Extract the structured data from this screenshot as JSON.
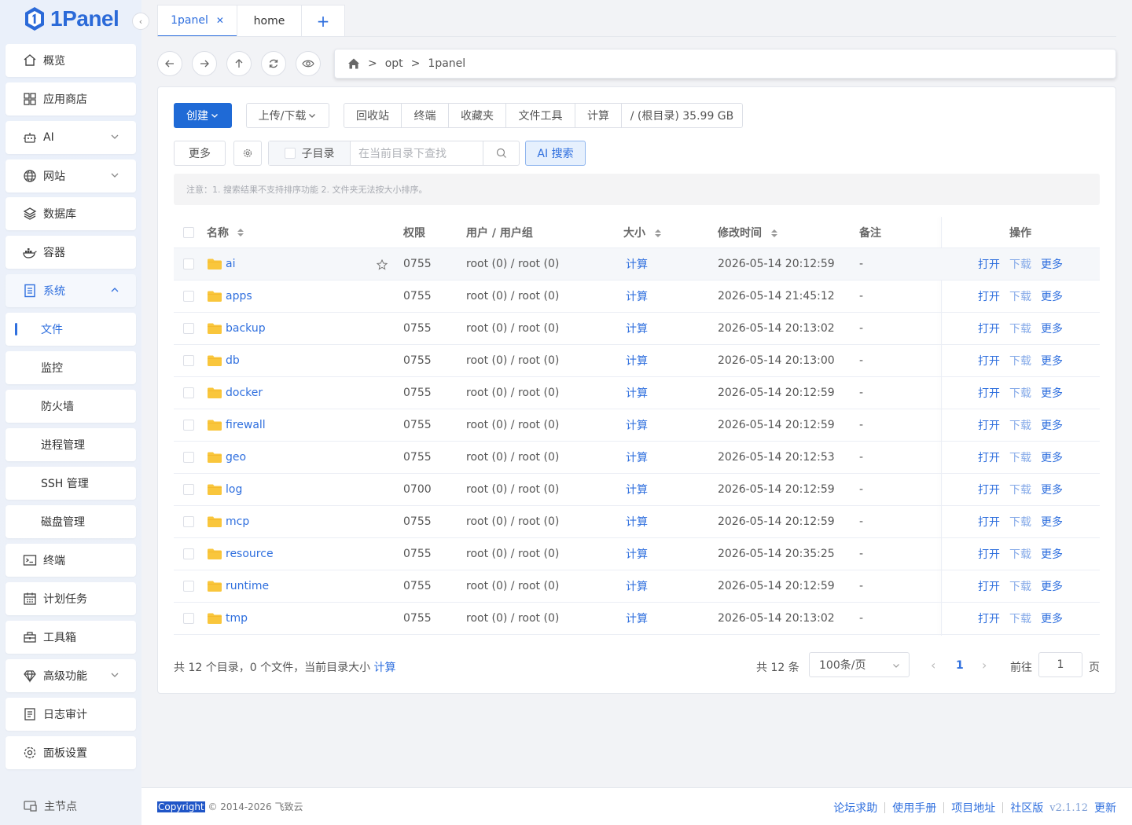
{
  "app": {
    "logo_text": "1Panel"
  },
  "sidebar": {
    "items": [
      {
        "label": "概览",
        "icon": "home-icon"
      },
      {
        "label": "应用商店",
        "icon": "apps-grid-icon"
      },
      {
        "label": "AI",
        "icon": "robot-icon",
        "expandable": true
      },
      {
        "label": "网站",
        "icon": "globe-icon",
        "expandable": true
      },
      {
        "label": "数据库",
        "icon": "database-layers-icon"
      },
      {
        "label": "容器",
        "icon": "docker-icon"
      },
      {
        "label": "系统",
        "icon": "system-doc-icon",
        "expanded": true
      },
      {
        "label": "文件",
        "active": true
      },
      {
        "label": "监控"
      },
      {
        "label": "防火墙"
      },
      {
        "label": "进程管理"
      },
      {
        "label": "SSH 管理"
      },
      {
        "label": "磁盘管理"
      },
      {
        "label": "终端",
        "icon": "terminal-icon"
      },
      {
        "label": "计划任务",
        "icon": "calendar-icon"
      },
      {
        "label": "工具箱",
        "icon": "toolbox-icon"
      },
      {
        "label": "高级功能",
        "icon": "diamond-icon",
        "expandable": true
      },
      {
        "label": "日志审计",
        "icon": "log-icon"
      },
      {
        "label": "面板设置",
        "icon": "settings-gear-icon"
      }
    ],
    "main_node": "主节点"
  },
  "tabs": [
    {
      "label": "1panel",
      "active": true
    },
    {
      "label": "home"
    }
  ],
  "breadcrumb": {
    "sep": ">",
    "parts": [
      "opt",
      "1panel"
    ]
  },
  "toolbar": {
    "create": "创建",
    "upload": "上传/下载",
    "group": [
      "回收站",
      "终端",
      "收藏夹",
      "文件工具",
      "计算",
      "/ (根目录) 35.99 GB"
    ],
    "more": "更多",
    "subdir": "子目录",
    "search_placeholder": "在当前目录下查找",
    "ai_search": "AI 搜索"
  },
  "notice": "注意：1. 搜索结果不支持排序功能 2. 文件夹无法按大小排序。",
  "table": {
    "headers": {
      "name": "名称",
      "perm": "权限",
      "user": "用户 / 用户组",
      "size": "大小",
      "time": "修改时间",
      "note": "备注",
      "ops": "操作"
    },
    "size_action": "计算",
    "ops": {
      "open": "打开",
      "download": "下载",
      "more": "更多"
    },
    "rows": [
      {
        "name": "ai",
        "perm": "0755",
        "user": "root (0) / root (0)",
        "time": "2026-05-14 20:12:59",
        "note": "-"
      },
      {
        "name": "apps",
        "perm": "0755",
        "user": "root (0) / root (0)",
        "time": "2026-05-14 21:45:12",
        "note": "-"
      },
      {
        "name": "backup",
        "perm": "0755",
        "user": "root (0) / root (0)",
        "time": "2026-05-14 20:13:02",
        "note": "-"
      },
      {
        "name": "db",
        "perm": "0755",
        "user": "root (0) / root (0)",
        "time": "2026-05-14 20:13:00",
        "note": "-"
      },
      {
        "name": "docker",
        "perm": "0755",
        "user": "root (0) / root (0)",
        "time": "2026-05-14 20:12:59",
        "note": "-"
      },
      {
        "name": "firewall",
        "perm": "0755",
        "user": "root (0) / root (0)",
        "time": "2026-05-14 20:12:59",
        "note": "-"
      },
      {
        "name": "geo",
        "perm": "0755",
        "user": "root (0) / root (0)",
        "time": "2026-05-14 20:12:53",
        "note": "-"
      },
      {
        "name": "log",
        "perm": "0700",
        "user": "root (0) / root (0)",
        "time": "2026-05-14 20:12:59",
        "note": "-"
      },
      {
        "name": "mcp",
        "perm": "0755",
        "user": "root (0) / root (0)",
        "time": "2026-05-14 20:12:59",
        "note": "-"
      },
      {
        "name": "resource",
        "perm": "0755",
        "user": "root (0) / root (0)",
        "time": "2026-05-14 20:35:25",
        "note": "-"
      },
      {
        "name": "runtime",
        "perm": "0755",
        "user": "root (0) / root (0)",
        "time": "2026-05-14 20:12:59",
        "note": "-"
      },
      {
        "name": "tmp",
        "perm": "0755",
        "user": "root (0) / root (0)",
        "time": "2026-05-14 20:13:02",
        "note": "-"
      }
    ]
  },
  "summary": {
    "text": "共 12 个目录，0 个文件，当前目录大小",
    "link": "计算"
  },
  "pagination": {
    "total": "共 12 条",
    "page_size": "100条/页",
    "current": "1",
    "goto_label": "前往",
    "goto_value": "1",
    "page_suffix": "页"
  },
  "footer": {
    "copyright_hl": "Copyright",
    "copyright_rest": "© 2014-2026 飞致云",
    "links": [
      "论坛求助",
      "使用手册",
      "项目地址",
      "社区版"
    ],
    "version": "v2.1.12",
    "update": "更新"
  },
  "colors": {
    "accent": "#2f6fde",
    "primary_button": "#1f6ad6",
    "folder": "#f9c63c"
  }
}
